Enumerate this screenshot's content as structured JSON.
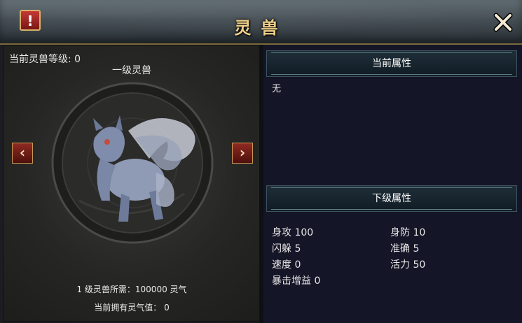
{
  "header": {
    "title": "灵兽",
    "alert_label": "!"
  },
  "left_panel": {
    "level_text": "当前灵兽等级: 0",
    "tier_label": "一级灵兽",
    "prev_arrow": "‹",
    "next_arrow": "›",
    "requirement_text": "1 级灵兽所需：100000 灵气",
    "owned_text": "当前拥有灵气值： 0"
  },
  "right_panel": {
    "current_header": "当前属性",
    "current_value": "无",
    "next_header": "下级属性",
    "stats": [
      {
        "text": "身攻 100"
      },
      {
        "text": "身防 10"
      },
      {
        "text": "闪躲 5"
      },
      {
        "text": "准确 5"
      },
      {
        "text": "速度 0"
      },
      {
        "text": "活力 50"
      },
      {
        "text": "暴击增益 0"
      }
    ]
  },
  "colors": {
    "title_gold": "#f0d08a",
    "panel_navy": "#141527",
    "arrow_red": "#8e2a22"
  }
}
